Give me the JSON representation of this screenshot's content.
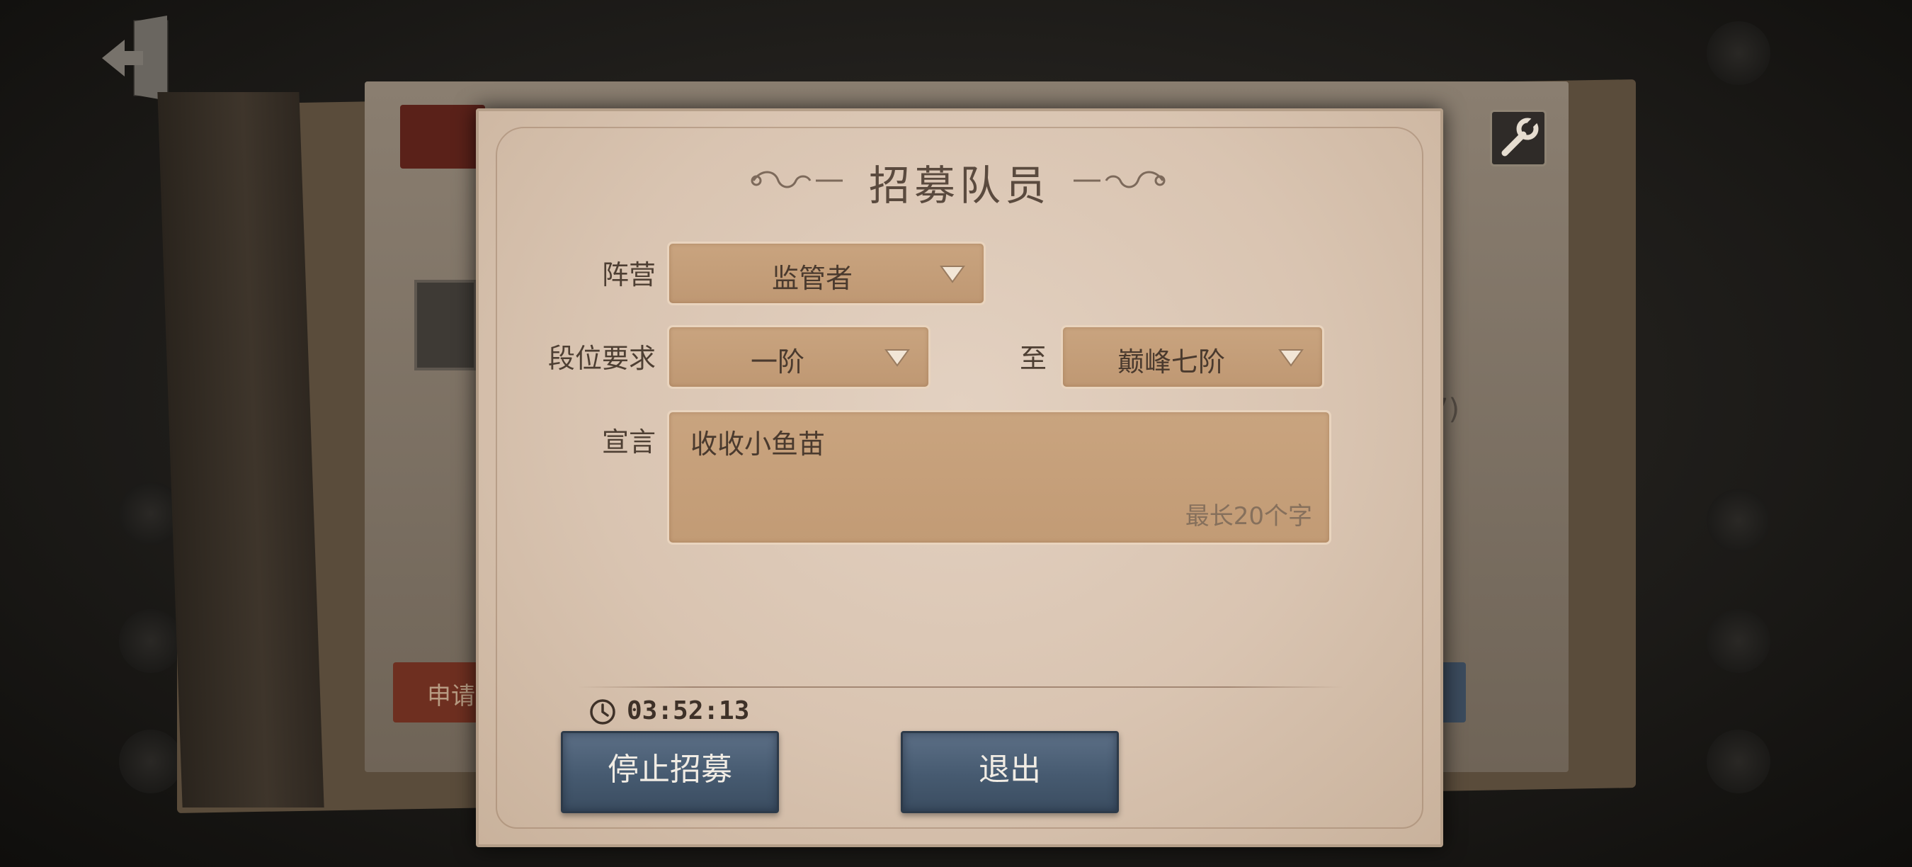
{
  "dialog": {
    "title": "招募队员",
    "faction_label": "阵营",
    "faction_value": "监管者",
    "rank_label": "段位要求",
    "rank_from": "一阶",
    "rank_to_label": "至",
    "rank_to": "巅峰七阶",
    "declaration_label": "宣言",
    "declaration_value": "收收小鱼苗",
    "declaration_hint": "最长20个字",
    "timer": "03:52:13",
    "stop_button": "停止招募",
    "exit_button": "退出"
  },
  "background": {
    "fragment_text": "7)",
    "apply_button_fragment": "申请"
  },
  "colors": {
    "dialog_bg": "#dcc8b5",
    "dropdown_bg": "#c6a07b",
    "button_bg": "#4a5e74",
    "text_dark": "#4e3f33"
  },
  "icons": [
    "exit-icon",
    "wrench-icon",
    "chevron-down-icon",
    "clock-icon",
    "title-ornament-icon"
  ]
}
